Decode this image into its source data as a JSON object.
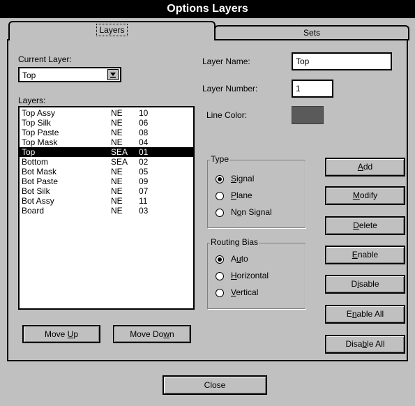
{
  "window": {
    "title": "Options Layers"
  },
  "tabs": [
    {
      "label": "Layers"
    },
    {
      "label": "Sets"
    }
  ],
  "current_layer": {
    "label": "Current Layer:",
    "value": "Top"
  },
  "layers_label": "Layers:",
  "layers": [
    {
      "name": "Top Assy",
      "type": "NE",
      "num": "10"
    },
    {
      "name": "Top Silk",
      "type": "NE",
      "num": "06"
    },
    {
      "name": "Top Paste",
      "type": "NE",
      "num": "08"
    },
    {
      "name": "Top Mask",
      "type": "NE",
      "num": "04"
    },
    {
      "name": "Top",
      "type": "SEA",
      "num": "01",
      "selected": true
    },
    {
      "name": "Bottom",
      "type": "SEA",
      "num": "02"
    },
    {
      "name": "Bot Mask",
      "type": "NE",
      "num": "05"
    },
    {
      "name": "Bot Paste",
      "type": "NE",
      "num": "09"
    },
    {
      "name": "Bot Silk",
      "type": "NE",
      "num": "07"
    },
    {
      "name": "Bot Assy",
      "type": "NE",
      "num": "11"
    },
    {
      "name": "Board",
      "type": "NE",
      "num": "03"
    }
  ],
  "layer_name": {
    "label": "Layer Name:",
    "value": "Top"
  },
  "layer_number": {
    "label": "Layer Number:",
    "value": "1"
  },
  "line_color": {
    "label": "Line Color:",
    "color": "#5a5a5a"
  },
  "type_group": {
    "title": "Type",
    "options": [
      {
        "pre": "",
        "key": "S",
        "post": "ignal",
        "checked": true
      },
      {
        "pre": "",
        "key": "P",
        "post": "lane",
        "checked": false
      },
      {
        "pre": "N",
        "key": "o",
        "post": "n Signal",
        "checked": false
      }
    ]
  },
  "routing_group": {
    "title": "Routing Bias",
    "options": [
      {
        "pre": "A",
        "key": "u",
        "post": "to",
        "checked": true
      },
      {
        "pre": "",
        "key": "H",
        "post": "orizontal",
        "checked": false
      },
      {
        "pre": "",
        "key": "V",
        "post": "ertical",
        "checked": false
      }
    ]
  },
  "buttons": {
    "add": {
      "pre": "",
      "key": "A",
      "post": "dd"
    },
    "modify": {
      "pre": "",
      "key": "M",
      "post": "odify"
    },
    "delete": {
      "pre": "",
      "key": "D",
      "post": "elete"
    },
    "enable": {
      "pre": "",
      "key": "E",
      "post": "nable"
    },
    "disable": {
      "pre": "D",
      "key": "i",
      "post": "sable"
    },
    "enable_all": {
      "pre": "E",
      "key": "n",
      "post": "able All"
    },
    "disable_all": {
      "pre": "Disa",
      "key": "b",
      "post": "le All"
    },
    "move_up": {
      "pre": "Move ",
      "key": "U",
      "post": "p"
    },
    "move_down": {
      "pre": "Move Do",
      "key": "w",
      "post": "n"
    },
    "close": {
      "label": "Close"
    }
  }
}
